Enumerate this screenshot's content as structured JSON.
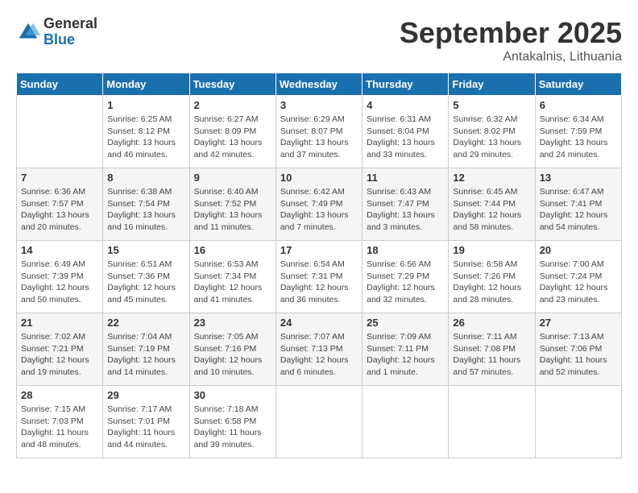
{
  "logo": {
    "general": "General",
    "blue": "Blue"
  },
  "title": "September 2025",
  "location": "Antakalnis, Lithuania",
  "weekdays": [
    "Sunday",
    "Monday",
    "Tuesday",
    "Wednesday",
    "Thursday",
    "Friday",
    "Saturday"
  ],
  "weeks": [
    [
      {
        "day": null
      },
      {
        "day": 1,
        "sunrise": "6:25 AM",
        "sunset": "8:12 PM",
        "daylight": "13 hours and 46 minutes."
      },
      {
        "day": 2,
        "sunrise": "6:27 AM",
        "sunset": "8:09 PM",
        "daylight": "13 hours and 42 minutes."
      },
      {
        "day": 3,
        "sunrise": "6:29 AM",
        "sunset": "8:07 PM",
        "daylight": "13 hours and 37 minutes."
      },
      {
        "day": 4,
        "sunrise": "6:31 AM",
        "sunset": "8:04 PM",
        "daylight": "13 hours and 33 minutes."
      },
      {
        "day": 5,
        "sunrise": "6:32 AM",
        "sunset": "8:02 PM",
        "daylight": "13 hours and 29 minutes."
      },
      {
        "day": 6,
        "sunrise": "6:34 AM",
        "sunset": "7:59 PM",
        "daylight": "13 hours and 24 minutes."
      }
    ],
    [
      {
        "day": 7,
        "sunrise": "6:36 AM",
        "sunset": "7:57 PM",
        "daylight": "13 hours and 20 minutes."
      },
      {
        "day": 8,
        "sunrise": "6:38 AM",
        "sunset": "7:54 PM",
        "daylight": "13 hours and 16 minutes."
      },
      {
        "day": 9,
        "sunrise": "6:40 AM",
        "sunset": "7:52 PM",
        "daylight": "13 hours and 11 minutes."
      },
      {
        "day": 10,
        "sunrise": "6:42 AM",
        "sunset": "7:49 PM",
        "daylight": "13 hours and 7 minutes."
      },
      {
        "day": 11,
        "sunrise": "6:43 AM",
        "sunset": "7:47 PM",
        "daylight": "13 hours and 3 minutes."
      },
      {
        "day": 12,
        "sunrise": "6:45 AM",
        "sunset": "7:44 PM",
        "daylight": "12 hours and 58 minutes."
      },
      {
        "day": 13,
        "sunrise": "6:47 AM",
        "sunset": "7:41 PM",
        "daylight": "12 hours and 54 minutes."
      }
    ],
    [
      {
        "day": 14,
        "sunrise": "6:49 AM",
        "sunset": "7:39 PM",
        "daylight": "12 hours and 50 minutes."
      },
      {
        "day": 15,
        "sunrise": "6:51 AM",
        "sunset": "7:36 PM",
        "daylight": "12 hours and 45 minutes."
      },
      {
        "day": 16,
        "sunrise": "6:53 AM",
        "sunset": "7:34 PM",
        "daylight": "12 hours and 41 minutes."
      },
      {
        "day": 17,
        "sunrise": "6:54 AM",
        "sunset": "7:31 PM",
        "daylight": "12 hours and 36 minutes."
      },
      {
        "day": 18,
        "sunrise": "6:56 AM",
        "sunset": "7:29 PM",
        "daylight": "12 hours and 32 minutes."
      },
      {
        "day": 19,
        "sunrise": "6:58 AM",
        "sunset": "7:26 PM",
        "daylight": "12 hours and 28 minutes."
      },
      {
        "day": 20,
        "sunrise": "7:00 AM",
        "sunset": "7:24 PM",
        "daylight": "12 hours and 23 minutes."
      }
    ],
    [
      {
        "day": 21,
        "sunrise": "7:02 AM",
        "sunset": "7:21 PM",
        "daylight": "12 hours and 19 minutes."
      },
      {
        "day": 22,
        "sunrise": "7:04 AM",
        "sunset": "7:19 PM",
        "daylight": "12 hours and 14 minutes."
      },
      {
        "day": 23,
        "sunrise": "7:05 AM",
        "sunset": "7:16 PM",
        "daylight": "12 hours and 10 minutes."
      },
      {
        "day": 24,
        "sunrise": "7:07 AM",
        "sunset": "7:13 PM",
        "daylight": "12 hours and 6 minutes."
      },
      {
        "day": 25,
        "sunrise": "7:09 AM",
        "sunset": "7:11 PM",
        "daylight": "12 hours and 1 minute."
      },
      {
        "day": 26,
        "sunrise": "7:11 AM",
        "sunset": "7:08 PM",
        "daylight": "11 hours and 57 minutes."
      },
      {
        "day": 27,
        "sunrise": "7:13 AM",
        "sunset": "7:06 PM",
        "daylight": "11 hours and 52 minutes."
      }
    ],
    [
      {
        "day": 28,
        "sunrise": "7:15 AM",
        "sunset": "7:03 PM",
        "daylight": "11 hours and 48 minutes."
      },
      {
        "day": 29,
        "sunrise": "7:17 AM",
        "sunset": "7:01 PM",
        "daylight": "11 hours and 44 minutes."
      },
      {
        "day": 30,
        "sunrise": "7:18 AM",
        "sunset": "6:58 PM",
        "daylight": "11 hours and 39 minutes."
      },
      {
        "day": null
      },
      {
        "day": null
      },
      {
        "day": null
      },
      {
        "day": null
      }
    ]
  ]
}
